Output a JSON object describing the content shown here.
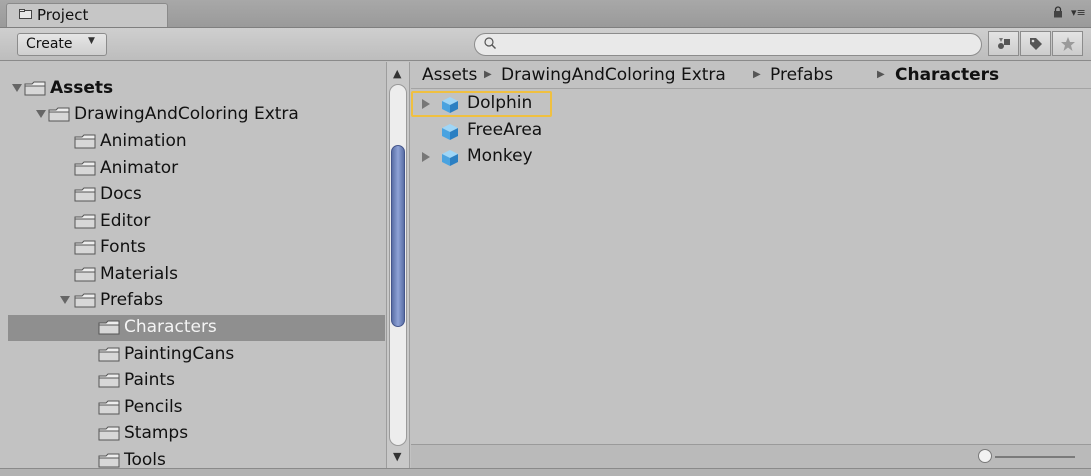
{
  "window": {
    "tab_title": "Project"
  },
  "toolbar": {
    "create_label": "Create",
    "search_placeholder": ""
  },
  "tree": {
    "items": [
      {
        "label": "Assets",
        "bold": true,
        "expanded": true,
        "depth": 0
      },
      {
        "label": "DrawingAndColoring Extra",
        "expanded": true,
        "depth": 1
      },
      {
        "label": "Animation",
        "depth": 2
      },
      {
        "label": "Animator",
        "depth": 2
      },
      {
        "label": "Docs",
        "depth": 2
      },
      {
        "label": "Editor",
        "depth": 2
      },
      {
        "label": "Fonts",
        "depth": 2
      },
      {
        "label": "Materials",
        "depth": 2
      },
      {
        "label": "Prefabs",
        "expanded": true,
        "depth": 2
      },
      {
        "label": "Characters",
        "selected": true,
        "depth": 3
      },
      {
        "label": "PaintingCans",
        "depth": 3
      },
      {
        "label": "Paints",
        "depth": 3
      },
      {
        "label": "Pencils",
        "depth": 3
      },
      {
        "label": "Stamps",
        "depth": 3
      },
      {
        "label": "Tools",
        "depth": 3
      }
    ]
  },
  "breadcrumb": [
    "Assets",
    "DrawingAndColoring Extra",
    "Prefabs",
    "Characters"
  ],
  "assets": {
    "items": [
      {
        "label": "Dolphin",
        "has_children": true,
        "highlighted": true
      },
      {
        "label": "FreeArea",
        "has_children": false
      },
      {
        "label": "Monkey",
        "has_children": true
      }
    ]
  },
  "colors": {
    "panel_bg": "#c2c2c2",
    "selection": "#8f8f8f",
    "highlight": "#f0c040",
    "prefab_cube": "#4aa3e0",
    "scroll_thumb": "#6f84bd"
  },
  "icons": {
    "tab": "folder-icon",
    "lock": "lock-icon",
    "menu": "panel-menu-icon",
    "search": "search-icon",
    "folder": "folder-icon",
    "prefab": "prefab-cube-icon"
  },
  "zoom_slider": {
    "level": 0.0
  }
}
